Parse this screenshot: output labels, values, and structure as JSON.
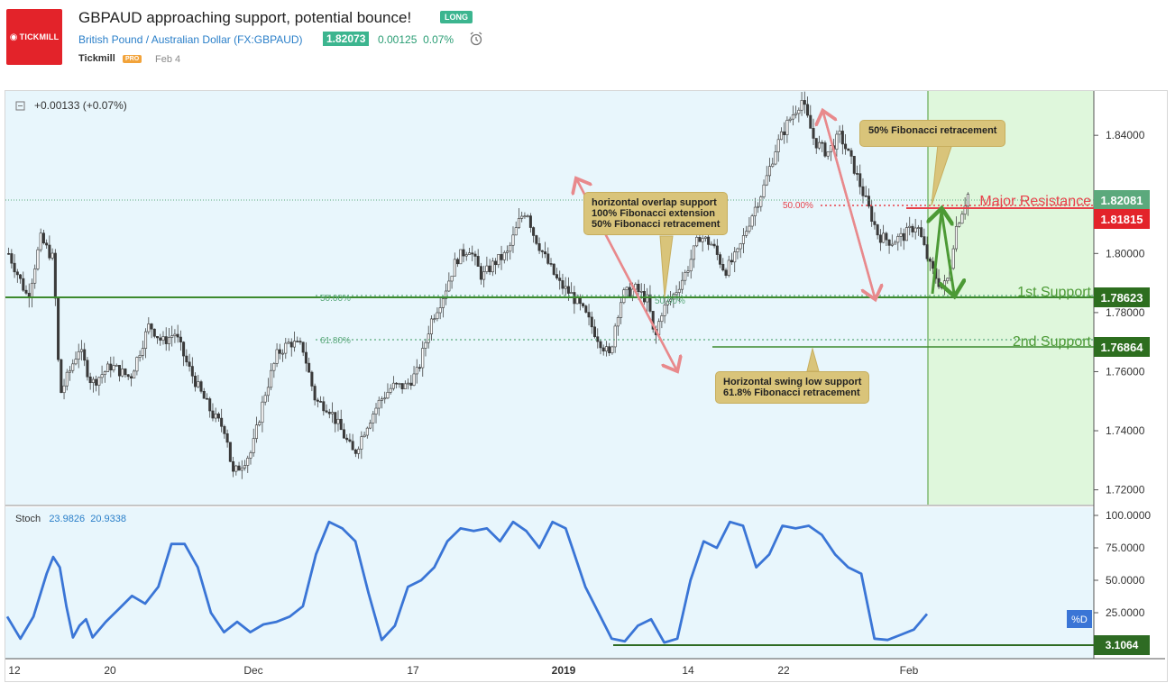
{
  "header": {
    "logo_text": "TICKMILL",
    "title": "GBPAUD approaching support, potential bounce!",
    "badge": "LONG",
    "symbol": "British Pound / Australian Dollar (FX:GBPAUD)",
    "price": "1.82073",
    "change": "0.00125",
    "change_pct": "0.07%",
    "author": "Tickmill",
    "pro_badge": "PRO",
    "date": "Feb 4"
  },
  "pane": {
    "change_text": "+0.00133 (+0.07%)",
    "stoch_label": "Stoch",
    "stoch_k": "23.9826",
    "stoch_d": "20.9338",
    "pct_d_label": "%D"
  },
  "annotations": {
    "box1": [
      "horizontal overlap support",
      "100% Fibonacci extension",
      "50% Fibonacci retracement"
    ],
    "box2": [
      "Horizontal swing low support",
      "61.8% Fibonacci retracement"
    ],
    "box3": "50% Fibonacci retracement",
    "major_resistance": "Major Resistance",
    "first_support": "1st Support",
    "second_support": "2nd Support",
    "fib_50_left": "50.00%",
    "fib_618_left": "61.80%",
    "fib_50_right": "50.00%",
    "fib_small_mid": "50.00%"
  },
  "colors": {
    "price_bg": "#e8f6fc",
    "forecast_bg": "#dff7dc",
    "support_line": "#3d8a2e",
    "resistance": "#e8414a",
    "arrow_pink": "#e8898c",
    "arrow_green": "#4c9a35",
    "stoch_line": "#3a75d6",
    "label_green": "#2d6e1f",
    "label_red": "#e3232a",
    "label_teal": "#5ba97c"
  },
  "chart_data": {
    "type": "candlestick",
    "symbol": "FX:GBPAUD",
    "ylim": [
      1.715,
      1.855
    ],
    "y_ticks": [
      "1.84000",
      "1.82000",
      "1.80000",
      "1.78000",
      "1.76000",
      "1.74000",
      "1.72000"
    ],
    "x_ticks": [
      "12",
      "20",
      "Dec",
      "17",
      "2019",
      "14",
      "22",
      "Feb"
    ],
    "price_labels": [
      {
        "value": "1.82081",
        "color": "#5ba97c"
      },
      {
        "value": "1.81815",
        "color": "#e3232a"
      },
      {
        "value": "1.78623",
        "color": "#2d6e1f"
      },
      {
        "value": "1.76864",
        "color": "#2d6e1f"
      }
    ],
    "levels": {
      "major_resistance": 1.8182,
      "first_support": 1.7862,
      "second_support": 1.7686,
      "current": 1.8208
    },
    "close_path": [
      [
        0,
        1.8
      ],
      [
        3,
        1.785
      ],
      [
        5,
        1.805
      ],
      [
        7,
        1.798
      ],
      [
        8,
        1.752
      ],
      [
        11,
        1.768
      ],
      [
        13,
        1.756
      ],
      [
        16,
        1.762
      ],
      [
        19,
        1.758
      ],
      [
        22,
        1.776
      ],
      [
        24,
        1.77
      ],
      [
        26,
        1.773
      ],
      [
        28,
        1.762
      ],
      [
        30,
        1.753
      ],
      [
        32,
        1.745
      ],
      [
        34,
        1.74
      ],
      [
        35,
        1.725
      ],
      [
        38,
        1.733
      ],
      [
        40,
        1.752
      ],
      [
        42,
        1.766
      ],
      [
        44,
        1.77
      ],
      [
        46,
        1.768
      ],
      [
        48,
        1.75
      ],
      [
        50,
        1.748
      ],
      [
        52,
        1.74
      ],
      [
        54,
        1.732
      ],
      [
        56,
        1.742
      ],
      [
        58,
        1.75
      ],
      [
        60,
        1.755
      ],
      [
        62,
        1.755
      ],
      [
        64,
        1.76
      ],
      [
        66,
        1.777
      ],
      [
        68,
        1.786
      ],
      [
        70,
        1.798
      ],
      [
        72,
        1.802
      ],
      [
        74,
        1.792
      ],
      [
        76,
        1.797
      ],
      [
        78,
        1.8
      ],
      [
        80,
        1.812
      ],
      [
        81,
        1.815
      ],
      [
        82,
        1.807
      ],
      [
        84,
        1.798
      ],
      [
        86,
        1.79
      ],
      [
        88,
        1.786
      ],
      [
        90,
        1.78
      ],
      [
        92,
        1.772
      ],
      [
        94,
        1.765
      ],
      [
        95,
        1.778
      ],
      [
        96,
        1.786
      ],
      [
        98,
        1.788
      ],
      [
        100,
        1.784
      ],
      [
        101,
        1.77
      ],
      [
        102,
        1.78
      ],
      [
        104,
        1.786
      ],
      [
        106,
        1.794
      ],
      [
        108,
        1.806
      ],
      [
        110,
        1.803
      ],
      [
        112,
        1.794
      ],
      [
        114,
        1.8
      ],
      [
        116,
        1.812
      ],
      [
        118,
        1.822
      ],
      [
        120,
        1.836
      ],
      [
        122,
        1.845
      ],
      [
        124,
        1.852
      ],
      [
        126,
        1.838
      ],
      [
        128,
        1.834
      ],
      [
        130,
        1.84
      ],
      [
        132,
        1.83
      ],
      [
        134,
        1.818
      ],
      [
        136,
        1.806
      ],
      [
        138,
        1.804
      ],
      [
        140,
        1.806
      ],
      [
        142,
        1.81
      ],
      [
        144,
        1.796
      ],
      [
        146,
        1.788
      ],
      [
        147,
        1.792
      ],
      [
        148,
        1.808
      ],
      [
        150,
        1.82
      ]
    ],
    "stochastic": {
      "k_current": 23.9826,
      "d_current": 20.9338,
      "ylim": [
        0,
        100
      ],
      "y_ticks": [
        "100.0000",
        "75.0000",
        "50.0000",
        "25.0000"
      ],
      "extra_label": "3.1064",
      "path": [
        [
          0,
          22
        ],
        [
          2,
          5
        ],
        [
          4,
          22
        ],
        [
          6,
          55
        ],
        [
          7,
          68
        ],
        [
          8,
          60
        ],
        [
          9,
          30
        ],
        [
          10,
          6
        ],
        [
          11,
          15
        ],
        [
          12,
          20
        ],
        [
          13,
          6
        ],
        [
          15,
          18
        ],
        [
          17,
          28
        ],
        [
          19,
          38
        ],
        [
          21,
          32
        ],
        [
          23,
          45
        ],
        [
          25,
          78
        ],
        [
          27,
          78
        ],
        [
          29,
          60
        ],
        [
          31,
          25
        ],
        [
          33,
          10
        ],
        [
          35,
          18
        ],
        [
          37,
          10
        ],
        [
          39,
          16
        ],
        [
          41,
          18
        ],
        [
          43,
          22
        ],
        [
          45,
          30
        ],
        [
          47,
          70
        ],
        [
          49,
          95
        ],
        [
          51,
          90
        ],
        [
          53,
          80
        ],
        [
          55,
          40
        ],
        [
          57,
          4
        ],
        [
          59,
          15
        ],
        [
          61,
          45
        ],
        [
          63,
          50
        ],
        [
          65,
          60
        ],
        [
          67,
          80
        ],
        [
          69,
          90
        ],
        [
          71,
          88
        ],
        [
          73,
          90
        ],
        [
          75,
          80
        ],
        [
          77,
          95
        ],
        [
          79,
          88
        ],
        [
          81,
          75
        ],
        [
          83,
          95
        ],
        [
          85,
          90
        ],
        [
          86,
          75
        ],
        [
          88,
          45
        ],
        [
          90,
          25
        ],
        [
          92,
          5
        ],
        [
          94,
          3
        ],
        [
          96,
          15
        ],
        [
          98,
          20
        ],
        [
          100,
          2
        ],
        [
          102,
          5
        ],
        [
          104,
          50
        ],
        [
          106,
          80
        ],
        [
          108,
          75
        ],
        [
          110,
          95
        ],
        [
          112,
          92
        ],
        [
          114,
          60
        ],
        [
          116,
          70
        ],
        [
          118,
          92
        ],
        [
          120,
          90
        ],
        [
          122,
          92
        ],
        [
          124,
          85
        ],
        [
          126,
          70
        ],
        [
          128,
          60
        ],
        [
          130,
          55
        ],
        [
          132,
          5
        ],
        [
          134,
          4
        ],
        [
          136,
          8
        ],
        [
          138,
          12
        ],
        [
          140,
          24
        ]
      ]
    }
  }
}
